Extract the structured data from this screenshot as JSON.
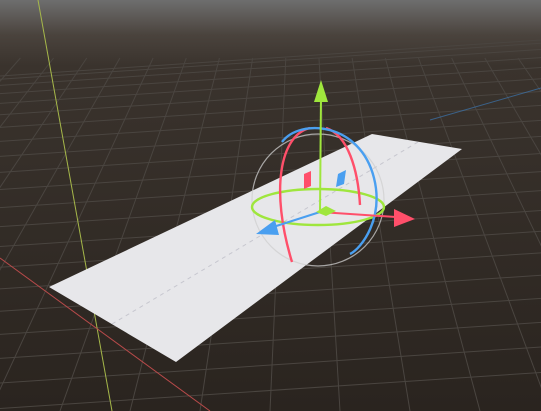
{
  "viewport": {
    "background_top": "#6e6e6e",
    "background_horizon": "#3a332d",
    "background_floor": "#2a241f",
    "grid_color": "#4a4540",
    "axis_x_color": "#b84a4a",
    "axis_y_color": "#a6b84a",
    "axis_z_color": "#3c6ea0"
  },
  "plane": {
    "fill": "#e7e7ea",
    "dash_color": "#c7c7cf"
  },
  "gizmo": {
    "tool": "transform",
    "x_color": "#ff4f6a",
    "y_color": "#9fe63d",
    "z_color": "#4a9ff0",
    "arcball_color": "#cfcfcf",
    "icons": [
      "move-arrow-x-icon",
      "move-arrow-y-icon",
      "move-arrow-z-icon",
      "rotate-ring-x-icon",
      "rotate-ring-y-icon",
      "rotate-ring-z-icon",
      "plane-handle-xy-icon",
      "plane-handle-yz-icon",
      "plane-handle-xz-icon"
    ]
  }
}
